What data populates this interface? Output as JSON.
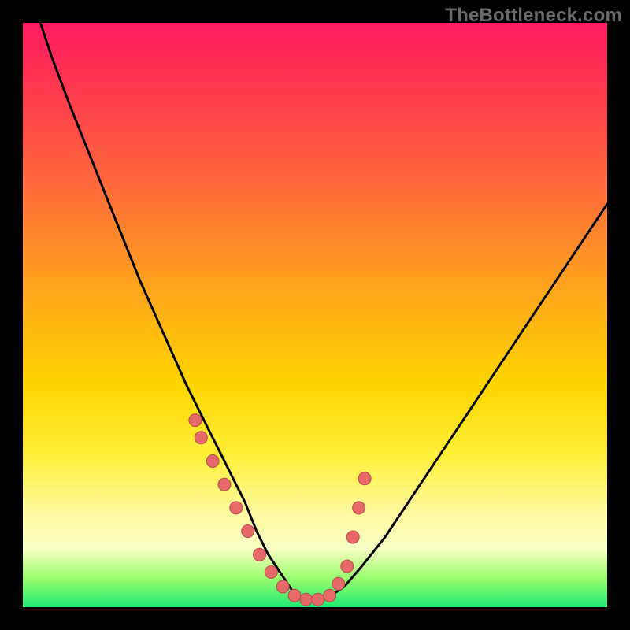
{
  "watermark": "TheBottleneck.com",
  "colors": {
    "curve": "#000000",
    "marker_fill": "#e66a6a",
    "marker_stroke": "#b84a4a"
  },
  "chart_data": {
    "type": "line",
    "title": "",
    "xlabel": "",
    "ylabel": "",
    "xlim": [
      0,
      100
    ],
    "ylim": [
      0,
      100
    ],
    "grid": false,
    "legend": false,
    "annotations": [],
    "series": [
      {
        "name": "curve",
        "x": [
          3,
          5,
          8,
          12,
          16,
          20,
          24,
          28,
          30,
          32,
          34,
          36,
          38,
          40,
          42,
          44,
          46,
          48,
          50,
          52,
          55,
          58,
          62,
          66,
          70,
          74,
          78,
          82,
          86,
          90,
          94,
          100
        ],
        "y": [
          100,
          94,
          86,
          76,
          66,
          56,
          47,
          38,
          34,
          30,
          26,
          22,
          18,
          13,
          9,
          6,
          3,
          1.5,
          1,
          1.5,
          3.5,
          7,
          12,
          18,
          24,
          30,
          36,
          42,
          48,
          54,
          60,
          69
        ]
      }
    ],
    "markers": {
      "name": "points",
      "x": [
        29.5,
        30.5,
        32.5,
        34.5,
        36.5,
        38.5,
        40.5,
        42.5,
        44.5,
        46.5,
        48.5,
        50.5,
        52.5,
        54.0,
        55.5,
        56.5,
        57.5,
        58.5
      ],
      "y": [
        32,
        29,
        25,
        21,
        17,
        13,
        9,
        6,
        3.5,
        2,
        1.3,
        1.3,
        2,
        4,
        7,
        12,
        17,
        22
      ]
    }
  }
}
